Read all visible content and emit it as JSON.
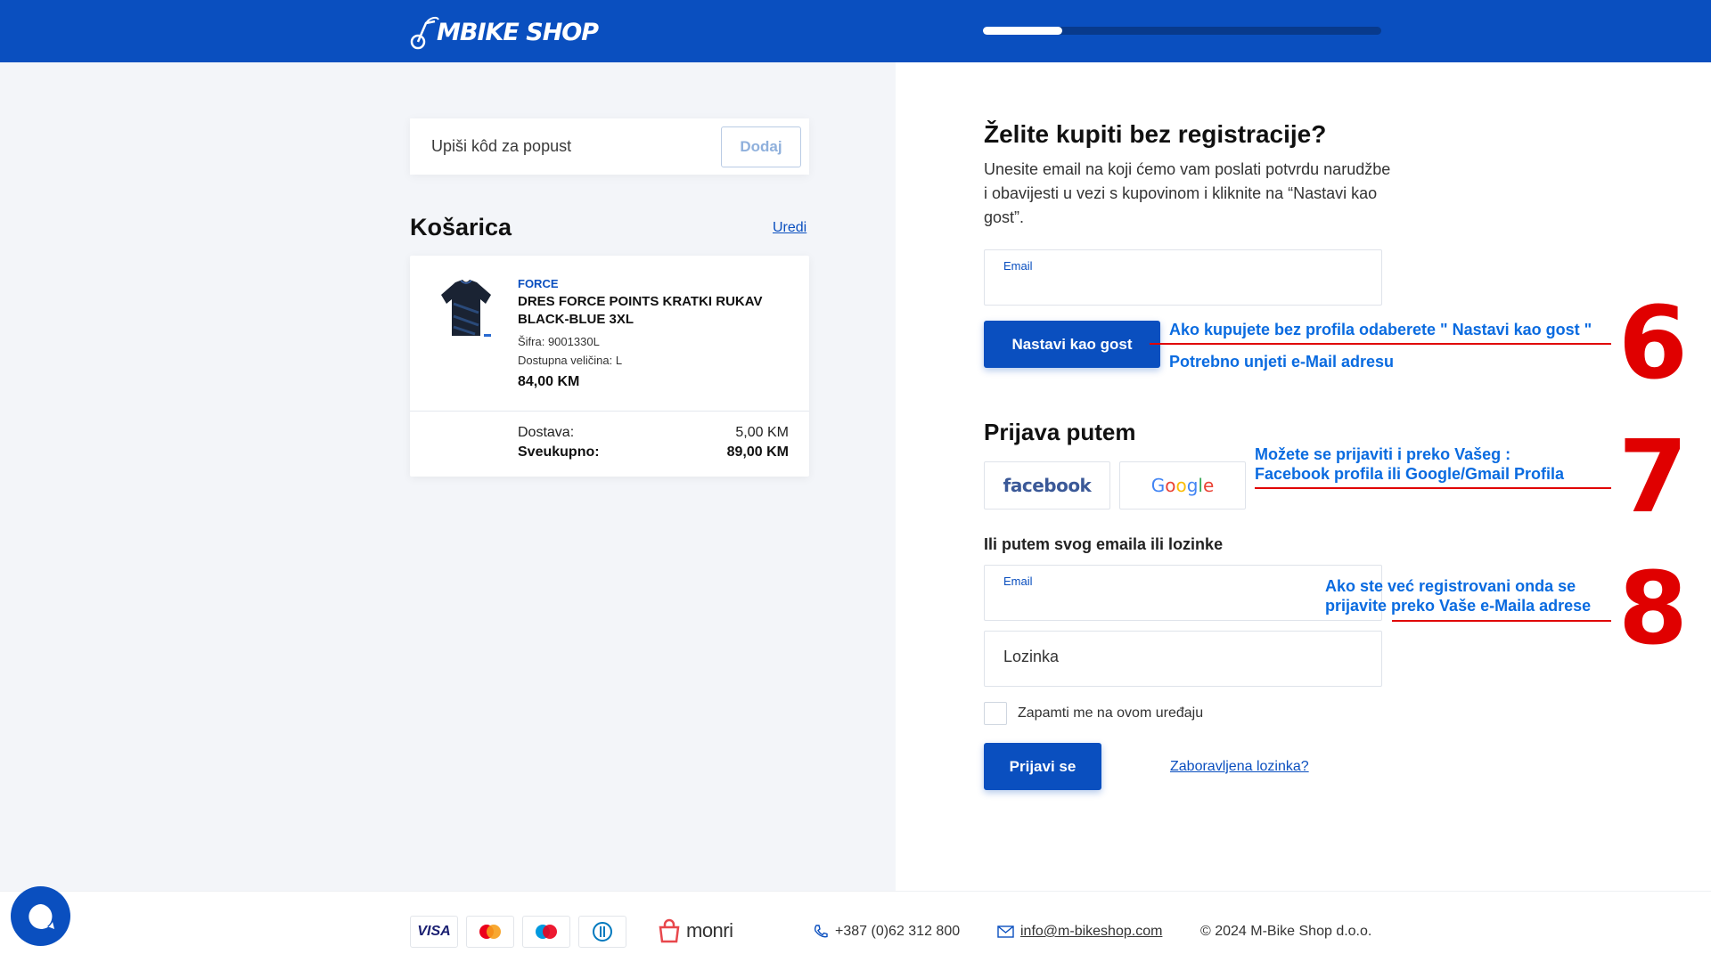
{
  "header": {
    "logo_text": "BIKE SHOP",
    "logo_letter": "M",
    "progress_fraction": 0.2
  },
  "coupon": {
    "placeholder": "Upiši kôd za popust",
    "button_label": "Dodaj"
  },
  "cart": {
    "title": "Košarica",
    "edit_label": "Uredi",
    "item": {
      "brand": "FORCE",
      "name": "DRES FORCE POINTS KRATKI RUKAV BLACK-BLUE 3XL",
      "sku": "Šifra: 9001330L",
      "size": "Dostupna veličina: L",
      "price": "84,00 KM"
    },
    "shipping_label": "Dostava:",
    "shipping_value": "5,00 KM",
    "total_label": "Sveukupno:",
    "total_value": "89,00 KM"
  },
  "guest": {
    "title": "Želite kupiti bez registracije?",
    "description": "Unesite email na koji ćemo vam poslati potvrdu narudžbe i obavijesti u vezi s kupovinom i kliknite na “Nastavi kao gost”.",
    "email_label": "Email",
    "email_value": "",
    "button_label": "Nastavi kao gost"
  },
  "social_login": {
    "title": "Prijava putem",
    "facebook_label": "facebook",
    "google_label": "Google"
  },
  "email_login": {
    "title": "Ili putem svog emaila ili lozinke",
    "email_label": "Email",
    "email_value": "",
    "password_placeholder": "Lozinka",
    "remember_label": "Zapamti me na ovom uređaju",
    "login_button_label": "Prijavi se",
    "forgot_label": "Zaboravljena lozinka?"
  },
  "annotations": {
    "step6_line1": "Ako kupujete bez profila odaberete \" Nastavi kao gost \"",
    "step6_line2": "Potrebno unjeti e-Mail adresu",
    "step6_number": "6",
    "step7_line1": "Možete se prijaviti i preko Vašeg :",
    "step7_line2": "Facebook profila ili Google/Gmail Profila",
    "step7_number": "7",
    "step8_line1": "Ako ste već registrovani onda se",
    "step8_line2": "prijavite preko Vaše e-Maila adrese",
    "step8_number": "8",
    "color": "#e00000",
    "text_color": "#0a6be0"
  },
  "footer": {
    "payment_cards": [
      "VISA",
      "mastercard-icon",
      "maestro-icon",
      "diners-icon"
    ],
    "visa_label": "VISA",
    "monri_label": "monri",
    "phone": "+387 (0)62 312 800",
    "email": "info@m-bikeshop.com",
    "copyright": "© 2024 M-Bike Shop d.o.o."
  },
  "colors": {
    "brand_blue": "#0a4fbf",
    "panel_bg": "#f3f5f9"
  }
}
